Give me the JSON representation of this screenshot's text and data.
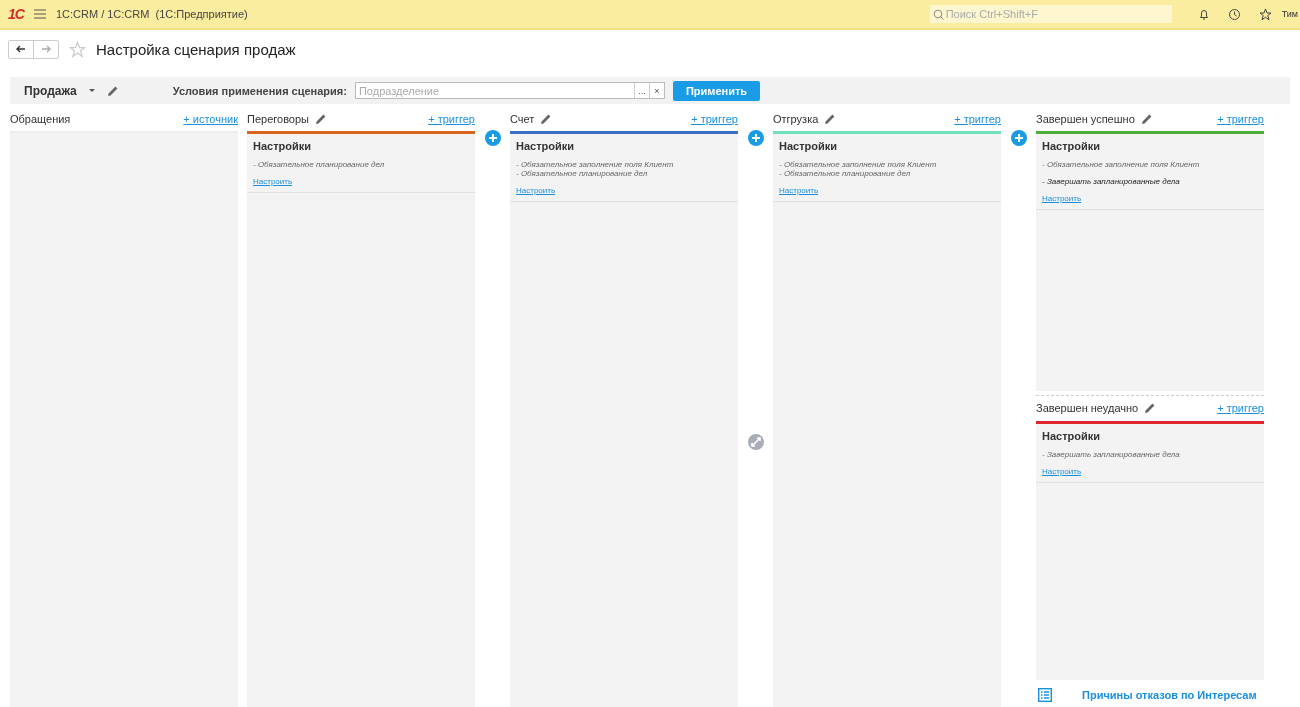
{
  "topbar": {
    "logo": "1С",
    "title": "1С:CRM / 1С:CRM  (1С:Предприятие)",
    "search": {
      "placeholder": "Поиск Ctrl+Shift+F"
    },
    "user": "Тим"
  },
  "page": {
    "title": "Настройка сценария продаж"
  },
  "toolbar": {
    "scenario": "Продажа",
    "conditions_label": "Условия применения сценария:",
    "field": {
      "placeholder": "Подразделение"
    },
    "choose": "...",
    "clear": "×",
    "apply": "Применить"
  },
  "source": {
    "name": "Обращения",
    "link": "+ источник"
  },
  "columns": [
    {
      "gap": {
        "add": true
      },
      "stages": [
        {
          "name": "Переговоры",
          "color": "#d9641e",
          "link": "+ триггер",
          "settings": "Настройки",
          "lines": [
            {
              "text": "- Обязательное планирование дел",
              "dark": false
            }
          ],
          "configure": "Настроить"
        }
      ]
    },
    {
      "gap": {
        "add": true,
        "swap": true
      },
      "stages": [
        {
          "name": "Счет",
          "color": "#3a6fc4",
          "link": "+ триггер",
          "settings": "Настройки",
          "lines": [
            {
              "text": "- Обязательное заполнение поля Клиент\n- Обязательное планирование дел",
              "dark": false
            }
          ],
          "configure": "Настроить"
        }
      ]
    },
    {
      "gap": {
        "add": true
      },
      "stages": [
        {
          "name": "Отгрузка",
          "color": "#6fe0b8",
          "link": "+ триггер",
          "settings": "Настройки",
          "lines": [
            {
              "text": "- Обязательное заполнение поля Клиент\n- Обязательное планирование дел",
              "dark": false
            }
          ],
          "configure": "Настроить"
        }
      ]
    },
    {
      "stages": [
        {
          "name": "Завершен успешно",
          "color": "#4caf3a",
          "link": "+ триггер",
          "settings": "Настройки",
          "lines": [
            {
              "text": "- Обязательное заполнение поля Клиент",
              "dark": false
            },
            {
              "text": "- Завершать запланированные дела",
              "dark": true
            }
          ],
          "configure": "Настроить"
        },
        {
          "name": "Завершен неудачно",
          "color": "#e0262c",
          "link": "+ триггер",
          "settings": "Настройки",
          "lines": [
            {
              "text": "- Завершать запланированные дела",
              "dark": false
            }
          ],
          "configure": "Настроить"
        }
      ],
      "footer": "Причины отказов по Интересам"
    }
  ]
}
